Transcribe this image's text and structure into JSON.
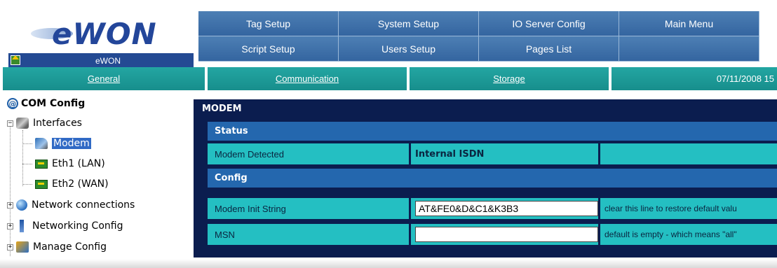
{
  "logo": {
    "brand": "eWON",
    "app_name": "eWON",
    "home_icon": "home-icon"
  },
  "menu": {
    "row1": [
      "Tag Setup",
      "System Setup",
      "IO Server Config",
      "Main Menu"
    ],
    "row2": [
      "Script Setup",
      "Users Setup",
      "Pages List",
      ""
    ]
  },
  "nav": {
    "general": "General",
    "communication": "Communication",
    "storage": "Storage",
    "datetime": "07/11/2008 15"
  },
  "tree": {
    "root": "COM Config",
    "interfaces": "Interfaces",
    "modem": "Modem",
    "eth1": "Eth1 (LAN)",
    "eth2": "Eth2 (WAN)",
    "network_connections": "Network connections",
    "networking_config": "Networking Config",
    "manage_config": "Manage Config"
  },
  "panel": {
    "title": "MODEM",
    "status_header": "Status",
    "modem_detected_label": "Modem Detected",
    "modem_detected_value": "Internal ISDN",
    "config_header": "Config",
    "init_string_label": "Modem Init String",
    "init_string_value": "AT&FE0&D&C1&K3B3",
    "init_string_hint": "clear this line to restore default valu",
    "msn_label": "MSN",
    "msn_value": "",
    "msn_hint": "default is empty - which means \"all\""
  },
  "colors": {
    "menu_blue": "#3465a0",
    "nav_teal": "#1b9a97",
    "panel_navy": "#0b1d4f",
    "cell_cyan": "#24bfc2",
    "section_blue": "#2467ae"
  }
}
